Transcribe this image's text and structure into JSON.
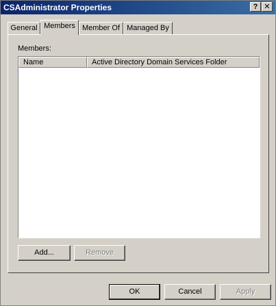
{
  "window": {
    "title": "CSAdministrator Properties",
    "help_glyph": "?",
    "close_glyph": "✕"
  },
  "tabs": [
    {
      "label": "General",
      "active": false
    },
    {
      "label": "Members",
      "active": true
    },
    {
      "label": "Member Of",
      "active": false
    },
    {
      "label": "Managed By",
      "active": false
    }
  ],
  "members": {
    "label": "Members:",
    "columns": [
      "Name",
      "Active Directory Domain Services Folder"
    ],
    "rows": [],
    "add_label": "Add...",
    "remove_label": "Remove"
  },
  "footer": {
    "ok_label": "OK",
    "cancel_label": "Cancel",
    "apply_label": "Apply"
  }
}
